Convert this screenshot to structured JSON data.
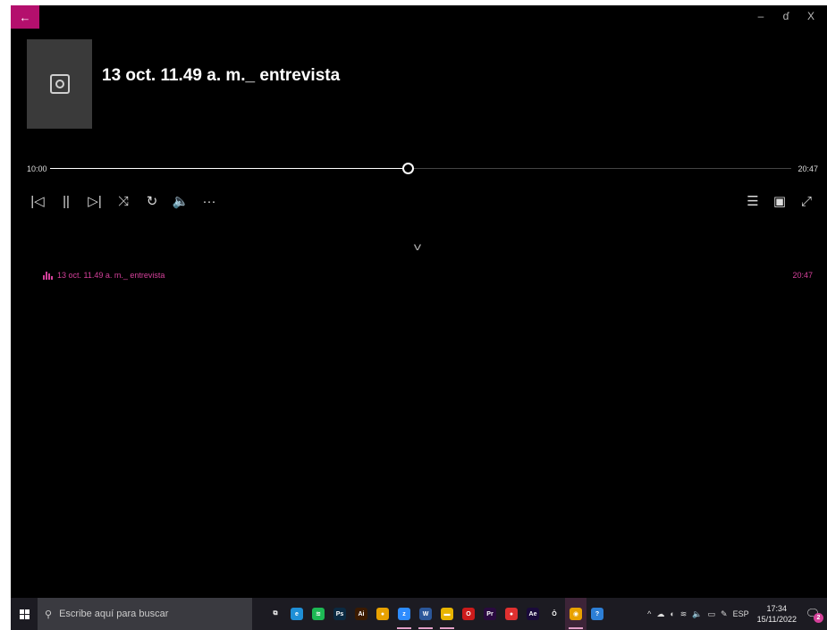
{
  "window": {
    "back_glyph": "←",
    "minimize_glyph": "–",
    "restore_glyph": "ɗ",
    "close_glyph": "X"
  },
  "now_playing": {
    "title": "13 oct. 11.49 a. m._ entrevista",
    "current_time": "10:00",
    "total_time": "20:47",
    "progress": 0.483
  },
  "controls": {
    "previous_glyph": "|◁",
    "pause_glyph": "||",
    "next_glyph": "▷|",
    "shuffle_glyph": "⤨",
    "repeat_glyph": "↻",
    "volume_glyph": "🔈",
    "more_glyph": "···",
    "queue_glyph": "☰",
    "mini_glyph": "▣",
    "fullscreen_glyph": "⤢",
    "collapse_glyph": "v"
  },
  "playlist": [
    {
      "name": "13 oct. 11.49 a. m._ entrevista",
      "duration": "20:47",
      "playing": true
    }
  ],
  "taskbar": {
    "search_placeholder": "Escribe aquí para buscar",
    "apps": [
      {
        "name": "task-view",
        "label": "⧉",
        "color": "#1c1b22",
        "open": false,
        "active": false
      },
      {
        "name": "edge",
        "label": "e",
        "color": "#1f8fd6",
        "open": false,
        "active": false
      },
      {
        "name": "spotify",
        "label": "≋",
        "color": "#1db954",
        "open": false,
        "active": false
      },
      {
        "name": "photoshop",
        "label": "Ps",
        "color": "#0b2a42",
        "open": false,
        "active": false
      },
      {
        "name": "illustrator",
        "label": "Ai",
        "color": "#3b1a00",
        "open": false,
        "active": false
      },
      {
        "name": "chrome",
        "label": "●",
        "color": "#e8a100",
        "open": false,
        "active": false
      },
      {
        "name": "zoom",
        "label": "z",
        "color": "#2d8cff",
        "open": true,
        "active": false
      },
      {
        "name": "word",
        "label": "W",
        "color": "#2b579a",
        "open": true,
        "active": false
      },
      {
        "name": "file-explorer",
        "label": "▬",
        "color": "#e8b400",
        "open": true,
        "active": false
      },
      {
        "name": "opera",
        "label": "O",
        "color": "#cc1b1b",
        "open": false,
        "active": false
      },
      {
        "name": "premiere",
        "label": "Pr",
        "color": "#2a0a40",
        "open": false,
        "active": false
      },
      {
        "name": "record",
        "label": "●",
        "color": "#e03030",
        "open": false,
        "active": false
      },
      {
        "name": "after-effects",
        "label": "Ae",
        "color": "#1a0a3a",
        "open": false,
        "active": false
      },
      {
        "name": "app-o",
        "label": "Ō",
        "color": "#1c1b22",
        "open": false,
        "active": false
      },
      {
        "name": "media-player",
        "label": "◉",
        "color": "#e8a100",
        "open": true,
        "active": true
      },
      {
        "name": "helper",
        "label": "?",
        "color": "#2d7fd6",
        "open": false,
        "active": false
      }
    ],
    "tray": {
      "chevron": "^",
      "cloud": "☁",
      "network": "◐",
      "wifi": "≋",
      "volume": "🔈",
      "battery": "▭",
      "pen": "✎",
      "language": "ESP"
    },
    "time": "17:34",
    "date": "15/11/2022",
    "notification_glyph": "🗨",
    "notification_count": "2"
  },
  "colors": {
    "accent": "#b40f6d",
    "playlist_text": "#d4409a"
  }
}
